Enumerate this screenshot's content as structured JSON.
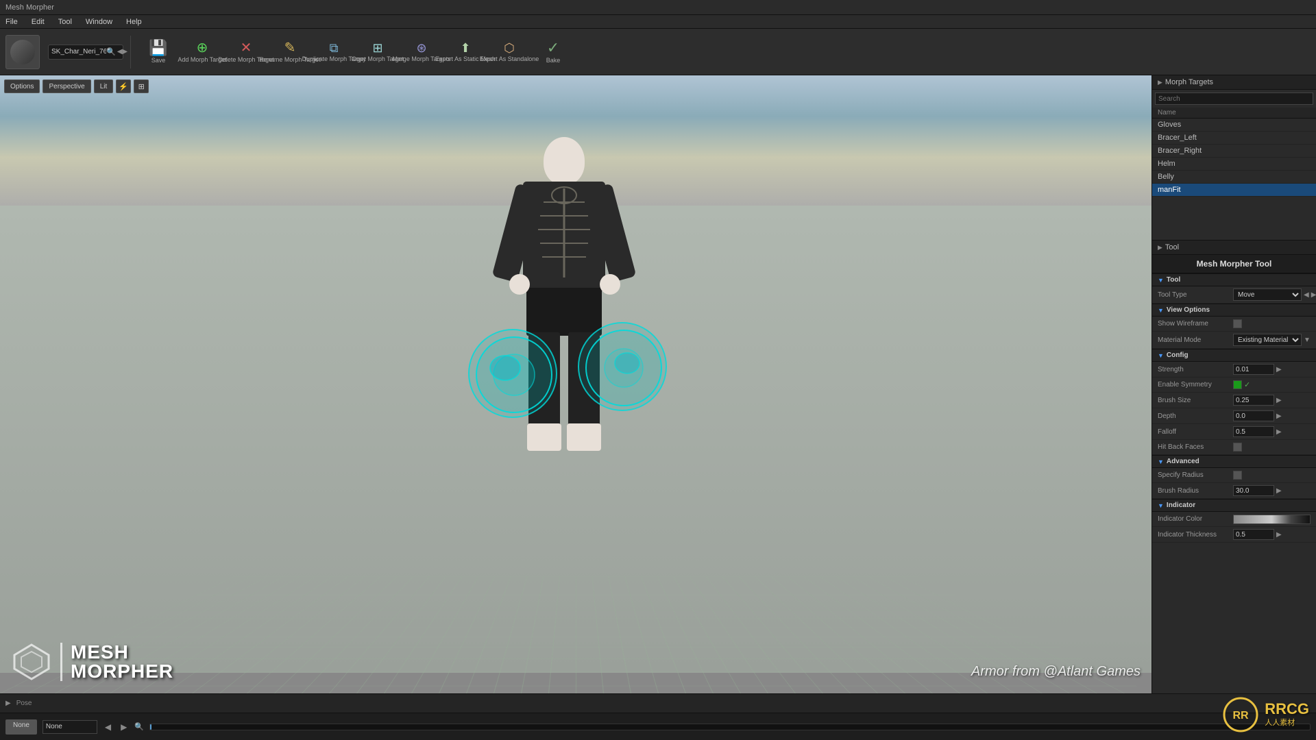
{
  "titleBar": {
    "title": "Mesh Morpher"
  },
  "menuBar": {
    "items": [
      "File",
      "Edit",
      "Tool",
      "Window",
      "Help"
    ]
  },
  "toolbar": {
    "searchPlaceholder": "SK_Char_Neri_76",
    "buttons": [
      {
        "id": "save",
        "label": "Save",
        "icon": "💾",
        "class": "save-btn"
      },
      {
        "id": "add-morph-target",
        "label": "Add Morph Target",
        "icon": "⊕",
        "class": "add-btn"
      },
      {
        "id": "delete-morph-target",
        "label": "Delete Morph Target",
        "icon": "✕",
        "class": "delete-btn"
      },
      {
        "id": "rename-morph-target",
        "label": "Rename Morph Target",
        "icon": "✎",
        "class": "rename-btn"
      },
      {
        "id": "duplicate-morph-target",
        "label": "Duplicate Morph Target",
        "icon": "⧉",
        "class": "dup-btn"
      },
      {
        "id": "copy-morph-target",
        "label": "Copy Morph Target",
        "icon": "⊞",
        "class": "copy-btn"
      },
      {
        "id": "merge-morph-targets",
        "label": "Merge Morph Targets",
        "icon": "⊛",
        "class": "merge-btn"
      },
      {
        "id": "export-as-static-mesh",
        "label": "Export As Static Mesh",
        "icon": "⬆",
        "class": "export-btn"
      },
      {
        "id": "export-as-standalone",
        "label": "Export As Standalone",
        "icon": "⬡",
        "class": "standalone-btn"
      },
      {
        "id": "bake",
        "label": "Bake",
        "icon": "✓",
        "class": "bake-btn"
      }
    ]
  },
  "viewport": {
    "overlayButtons": [
      "Options",
      "Perspective",
      "Lit"
    ],
    "watermark": "Armor from @Atlant Games"
  },
  "logo": {
    "line1": "MESH",
    "line2": "MORPHER"
  },
  "rightPanel": {
    "morphTargets": {
      "header": "Morph Targets",
      "searchPlaceholder": "Search",
      "colHeader": "Name",
      "items": [
        {
          "name": "Gloves",
          "selected": false
        },
        {
          "name": "Bracer_Left",
          "selected": false
        },
        {
          "name": "Bracer_Right",
          "selected": false
        },
        {
          "name": "Helm",
          "selected": false
        },
        {
          "name": "Belly",
          "selected": false
        },
        {
          "name": "manFit",
          "selected": true
        }
      ]
    },
    "tool": {
      "sectionHeader": "Tool",
      "panelTitle": "Mesh Morpher Tool",
      "toolSection": {
        "header": "Tool",
        "toolTypeLabel": "Tool Type",
        "toolTypeValue": "Move"
      },
      "viewOptions": {
        "header": "View Options",
        "showWireframeLabel": "Show Wireframe",
        "materialModeLabel": "Material Mode",
        "materialModeValue": "Existing Material"
      },
      "config": {
        "header": "Config",
        "strengthLabel": "Strength",
        "strengthValue": "0.01",
        "enableSymmetryLabel": "Enable Symmetry",
        "brushSizeLabel": "Brush Size",
        "brushSizeValue": "0.25",
        "depthLabel": "Depth",
        "depthValue": "0.0",
        "falloffLabel": "Falloff",
        "falloffValue": "0.5",
        "hitBackFacesLabel": "Hit Back Faces"
      },
      "advanced": {
        "header": "Advanced",
        "specifyRadiusLabel": "Specify Radius",
        "brushRadiusLabel": "Brush Radius",
        "brushRadiusValue": "30.0"
      },
      "indicator": {
        "header": "Indicator",
        "colorLabel": "Indicator Color",
        "thicknessLabel": "Indicator Thickness",
        "thicknessValue": "0.5"
      }
    }
  },
  "bottomBar": {
    "poseLabel": "Pose"
  },
  "timeline": {
    "noneLabel": "None",
    "inputPlaceholder": "None"
  },
  "rrcg": {
    "text": "RRCG",
    "subtext": "人人素材"
  }
}
